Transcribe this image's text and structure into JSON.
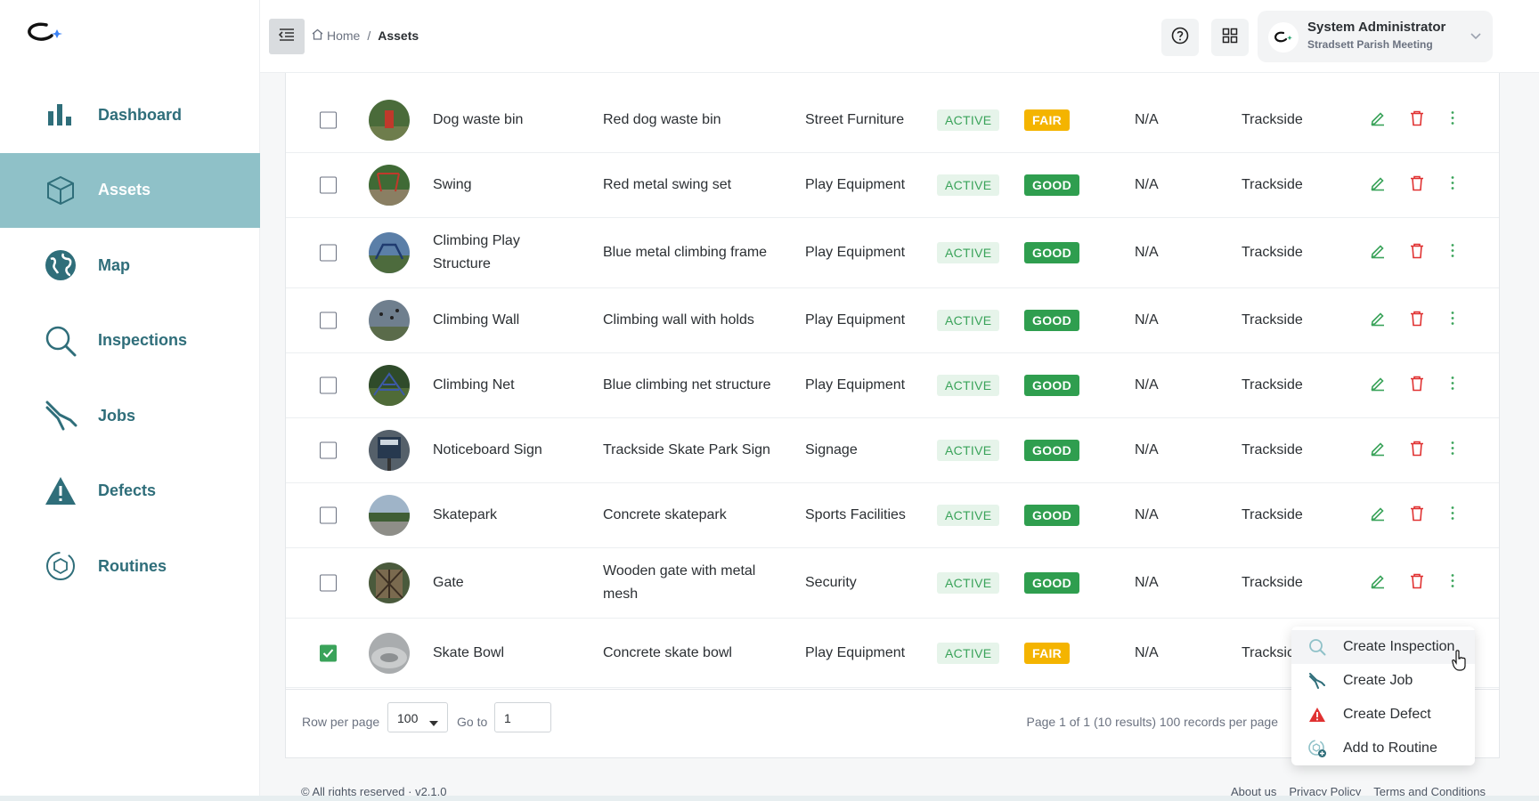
{
  "app": {
    "header": {
      "breadcrumb": {
        "home": "Home",
        "separator": "/",
        "current": "Assets"
      },
      "user": {
        "name": "System Administrator",
        "org": "Stradsett Parish Meeting"
      }
    },
    "sidebar": {
      "items": [
        {
          "label": "Dashboard",
          "icon": "bar-chart-icon",
          "active": false
        },
        {
          "label": "Assets",
          "icon": "cube-icon",
          "active": true
        },
        {
          "label": "Map",
          "icon": "globe-icon",
          "active": false
        },
        {
          "label": "Inspections",
          "icon": "magnifier-icon",
          "active": false
        },
        {
          "label": "Jobs",
          "icon": "pliers-icon",
          "active": false
        },
        {
          "label": "Defects",
          "icon": "warning-icon",
          "active": false
        },
        {
          "label": "Routines",
          "icon": "routine-cycle-icon",
          "active": false
        }
      ]
    },
    "table": {
      "rows": [
        {
          "name": "Dog waste bin",
          "description": "Red dog waste bin",
          "category": "Street Furniture",
          "status": "ACTIVE",
          "condition": "FAIR",
          "value": "N/A",
          "location": "Trackside",
          "checked": false
        },
        {
          "name": "Swing",
          "description": "Red metal swing set",
          "category": "Play Equipment",
          "status": "ACTIVE",
          "condition": "GOOD",
          "value": "N/A",
          "location": "Trackside",
          "checked": false
        },
        {
          "name_l1": "Climbing Play",
          "name_l2": "Structure",
          "description": "Blue metal climbing frame",
          "category": "Play Equipment",
          "status": "ACTIVE",
          "condition": "GOOD",
          "value": "N/A",
          "location": "Trackside",
          "checked": false
        },
        {
          "name": "Climbing Wall",
          "description": "Climbing wall with holds",
          "category": "Play Equipment",
          "status": "ACTIVE",
          "condition": "GOOD",
          "value": "N/A",
          "location": "Trackside",
          "checked": false
        },
        {
          "name": "Climbing Net",
          "description": "Blue climbing net structure",
          "category": "Play Equipment",
          "status": "ACTIVE",
          "condition": "GOOD",
          "value": "N/A",
          "location": "Trackside",
          "checked": false
        },
        {
          "name": "Noticeboard Sign",
          "description": "Trackside Skate Park Sign",
          "category": "Signage",
          "status": "ACTIVE",
          "condition": "GOOD",
          "value": "N/A",
          "location": "Trackside",
          "checked": false
        },
        {
          "name": "Skatepark",
          "description": "Concrete skatepark",
          "category": "Sports Facilities",
          "status": "ACTIVE",
          "condition": "GOOD",
          "value": "N/A",
          "location": "Trackside",
          "checked": false
        },
        {
          "name": "Gate",
          "description_l1": "Wooden gate with metal",
          "description_l2": "mesh",
          "category": "Security",
          "status": "ACTIVE",
          "condition": "GOOD",
          "value": "N/A",
          "location": "Trackside",
          "checked": false
        },
        {
          "name": "Skate Bowl",
          "description": "Concrete skate bowl",
          "category": "Play Equipment",
          "status": "ACTIVE",
          "condition": "FAIR",
          "value": "N/A",
          "location": "Tracksic",
          "checked": true
        }
      ],
      "pager": {
        "rows_label": "Row per page",
        "rows_value": "100",
        "goto_label": "Go to",
        "goto_value": "1",
        "info": "Page 1 of 1 (10 results) 100 records per page"
      }
    },
    "context_menu": {
      "items": [
        {
          "label": "Create Inspection",
          "icon": "magnifier-icon"
        },
        {
          "label": "Create Job",
          "icon": "pliers-icon"
        },
        {
          "label": "Create Defect",
          "icon": "warning-icon"
        },
        {
          "label": "Add to Routine",
          "icon": "routine-add-icon"
        }
      ]
    },
    "footer": {
      "copyright": "© All rights reserved · v2.1.0",
      "links": [
        "About us",
        "Privacy Policy",
        "Terms and Conditions"
      ]
    },
    "colors": {
      "accent": "#8fc1c8",
      "nav_text": "#2f6e7a",
      "good": "#2f9e4f",
      "fair": "#f4b400",
      "active_status": "#3aa35a"
    }
  }
}
